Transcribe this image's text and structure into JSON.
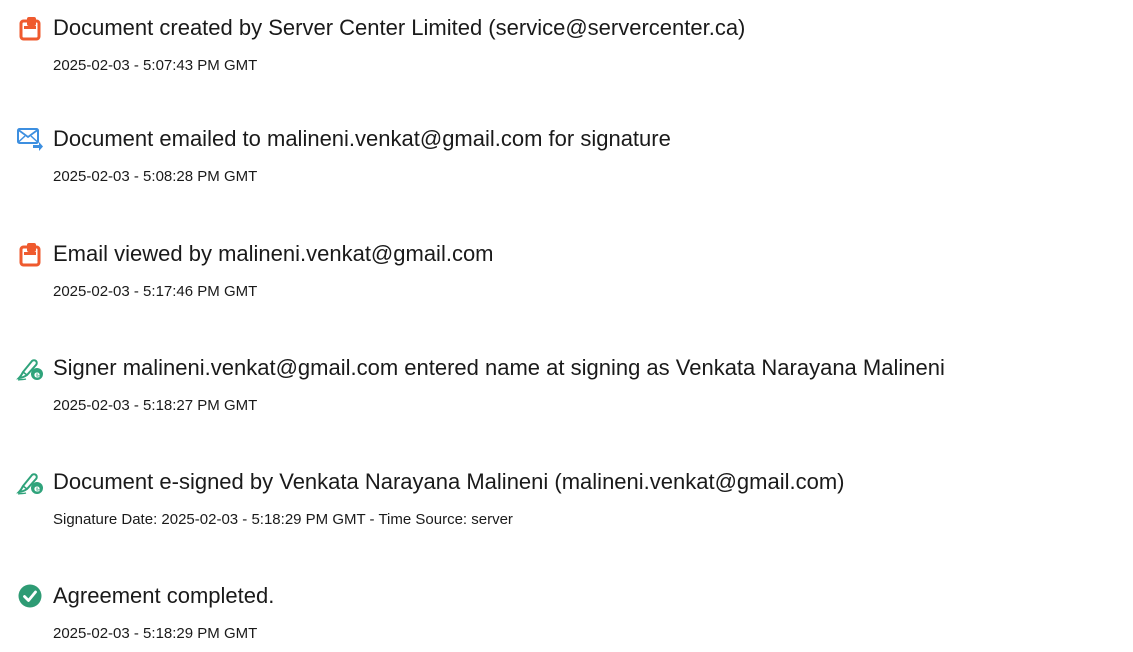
{
  "events": [
    {
      "icon": "document-created-icon",
      "title": "Document created by Server Center Limited (service@servercenter.ca)",
      "timestamp": "2025-02-03 - 5:07:43 PM GMT"
    },
    {
      "icon": "email-sent-icon",
      "title": "Document emailed to malineni.venkat@gmail.com for signature",
      "timestamp": "2025-02-03 - 5:08:28 PM GMT"
    },
    {
      "icon": "document-viewed-icon",
      "title": "Email viewed by malineni.venkat@gmail.com",
      "timestamp": "2025-02-03 - 5:17:46 PM GMT"
    },
    {
      "icon": "signer-pen-icon",
      "title": "Signer malineni.venkat@gmail.com entered name at signing as Venkata Narayana Malineni",
      "timestamp": "2025-02-03 - 5:18:27 PM GMT"
    },
    {
      "icon": "e-signed-pen-icon",
      "title": "Document e-signed by Venkata Narayana Malineni (malineni.venkat@gmail.com)",
      "timestamp": "Signature Date: 2025-02-03 - 5:18:29 PM GMT - Time Source: server"
    },
    {
      "icon": "check-circle-icon",
      "title": "Agreement completed.",
      "timestamp": "2025-02-03 - 5:18:29 PM GMT"
    }
  ],
  "colors": {
    "document_orange": "#ef5a2e",
    "email_blue": "#3d8fe0",
    "pen_green": "#2fa37b",
    "check_green": "#2e9b74",
    "text": "#1a1a1a"
  }
}
